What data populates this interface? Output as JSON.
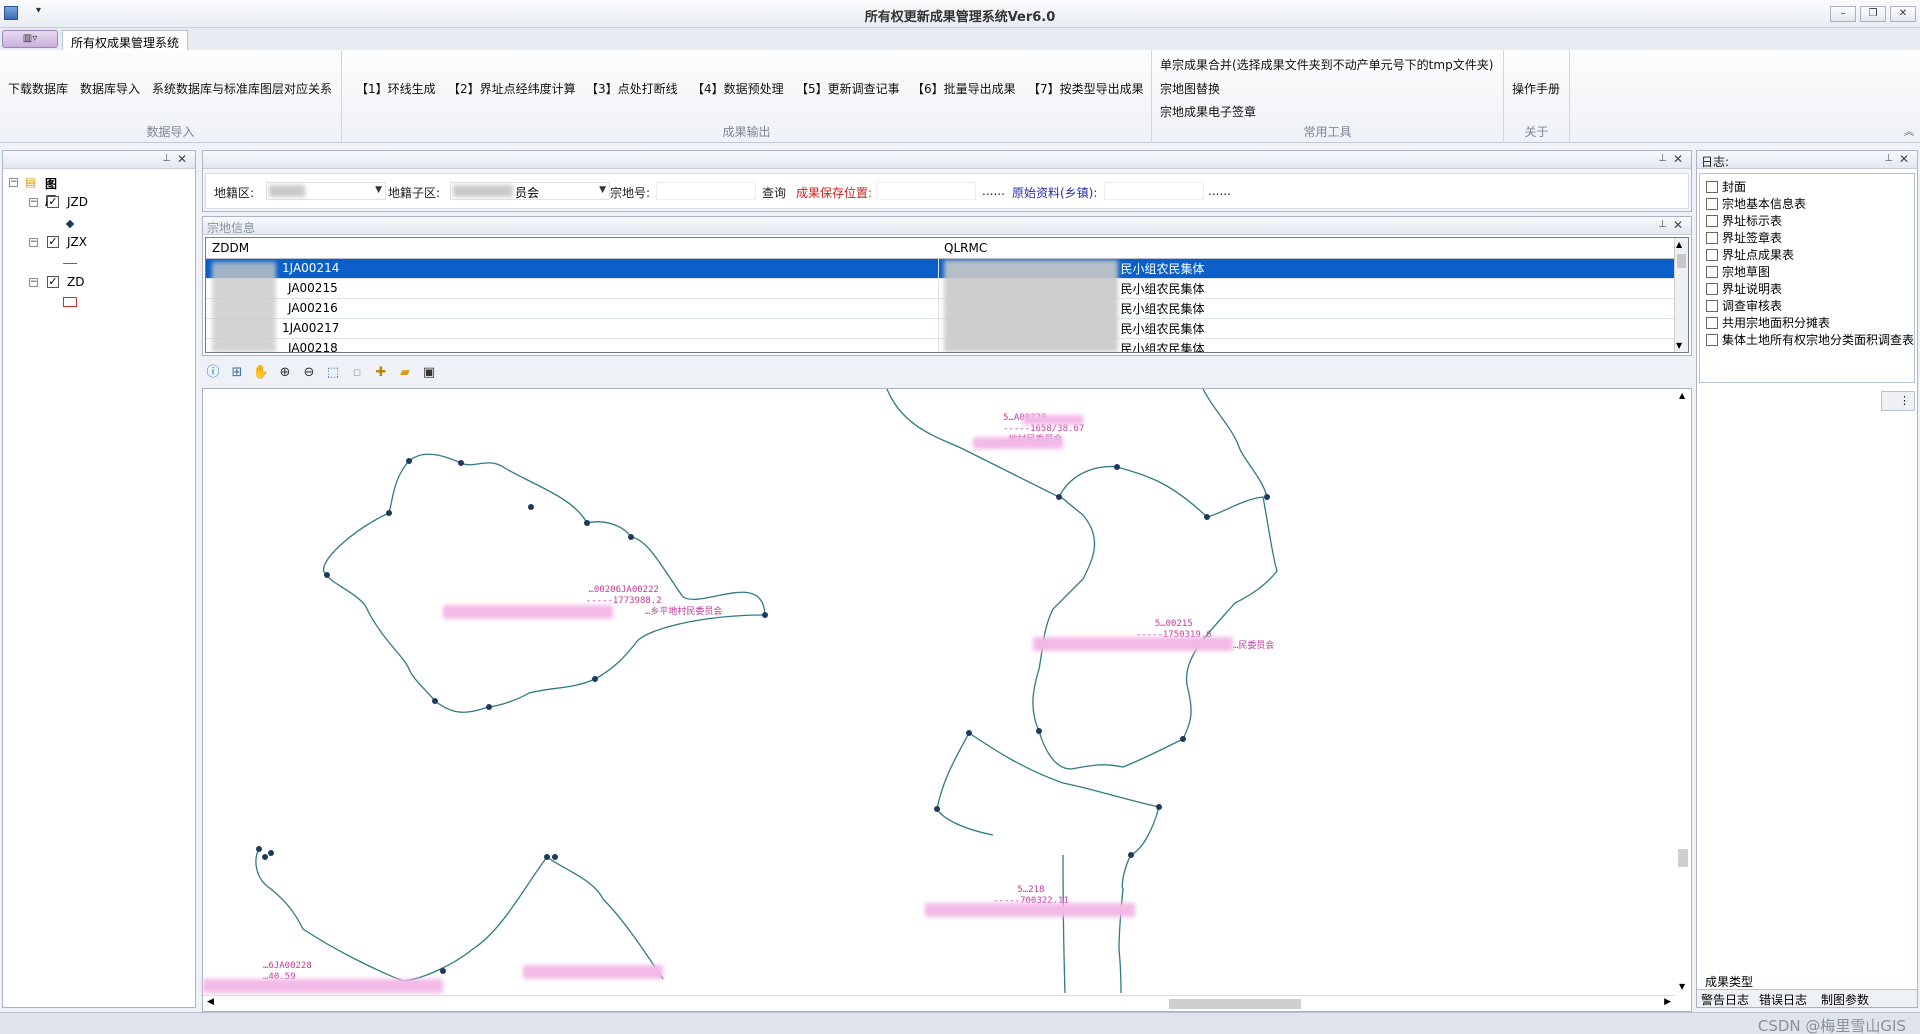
{
  "window": {
    "title": "所有权更新成果管理系统Ver6.0",
    "qat_arrow": "▾",
    "btn_min": "–",
    "btn_restore": "❐",
    "btn_close": "✕"
  },
  "ribbon": {
    "app_menu": "▥▿",
    "tab": "所有权成果管理系统",
    "groups": {
      "import": {
        "caption": "数据导入",
        "buttons": [
          "下载数据库",
          "数据库导入",
          "系统数据库与标准库图层对应关系"
        ]
      },
      "output": {
        "caption": "成果输出",
        "buttons": [
          "【1】环线生成",
          "【2】界址点经纬度计算",
          "【3】点处打断线",
          "【4】数据预处理",
          "【5】更新调查记事",
          "【6】批量导出成果",
          "【7】按类型导出成果"
        ]
      },
      "tools": {
        "caption": "常用工具",
        "buttons": [
          "单宗成果合并(选择成果文件夹到不动产单元号下的tmp文件夹)",
          "宗地图替换",
          "宗地成果电子签章"
        ]
      },
      "about": {
        "caption": "关于",
        "buttons": [
          "操作手册"
        ]
      }
    }
  },
  "layers_panel": {
    "root": "图层",
    "layers": [
      {
        "name": "JZD",
        "checked": true,
        "symbol": "point"
      },
      {
        "name": "JZX",
        "checked": true,
        "symbol": "line"
      },
      {
        "name": "ZD",
        "checked": true,
        "symbol": "polygon"
      }
    ]
  },
  "query": {
    "district_label": "地籍区:",
    "subdistrict_label": "地籍子区:",
    "subdistrict_value_suffix": "员会",
    "parcel_label": "宗地号:",
    "query_btn": "查询",
    "save_label": "成果保存位置:",
    "save_browse": "......",
    "source_label": "原始资料(乡镇):",
    "source_browse": "......"
  },
  "parcel_info": {
    "title": "宗地信息",
    "columns": [
      "ZDDM",
      "QLRMC"
    ],
    "rows": [
      {
        "zddm": "1JA00214",
        "qlrmc": "民小组农民集体",
        "selected": true
      },
      {
        "zddm": "JA00215",
        "qlrmc": "民小组农民集体",
        "selected": false
      },
      {
        "zddm": "JA00216",
        "qlrmc": "民小组农民集体",
        "selected": false
      },
      {
        "zddm": "1JA00217",
        "qlrmc": "民小组农民集体",
        "selected": false
      },
      {
        "zddm": "JA00218",
        "qlrmc": "民小组农民集体",
        "selected": false
      }
    ]
  },
  "map": {
    "labels": [
      {
        "code": "5…A00220",
        "area": "-----1658/38.67",
        "owner": "…地村民委员会"
      },
      {
        "code": "…00206JA00222",
        "area": "-----1773988.2",
        "owner": "…乡平地村民委员会"
      },
      {
        "code": "5…00215",
        "area": "-----1750319.6",
        "owner": "…民委员会"
      },
      {
        "code": "5…218",
        "area": "-----700322.11",
        "owner": ""
      },
      {
        "code": "…6JA00228",
        "area": "…40.59",
        "owner": ""
      }
    ]
  },
  "log_panel": {
    "title": "日志:",
    "items": [
      "封面",
      "宗地基本信息表",
      "界址标示表",
      "界址签章表",
      "界址点成果表",
      "宗地草图",
      "界址说明表",
      "调查审核表",
      "共用宗地面积分摊表",
      "集体土地所有权宗地分类面积调查表"
    ],
    "side_btn": "⋮",
    "tabs_top": [
      "成果类型"
    ],
    "tabs_bottom": [
      "警告日志",
      "错误日志",
      "制图参数"
    ]
  },
  "watermark": "CSDN @梅里雪山GIS",
  "colors": {
    "selection": "#0a5fc8",
    "polygon_line": "#2f7a84",
    "vertex": "#1f3a5c",
    "map_label": "#c0389a",
    "save_label": "#d02020",
    "source_label": "#2a2ab0"
  }
}
